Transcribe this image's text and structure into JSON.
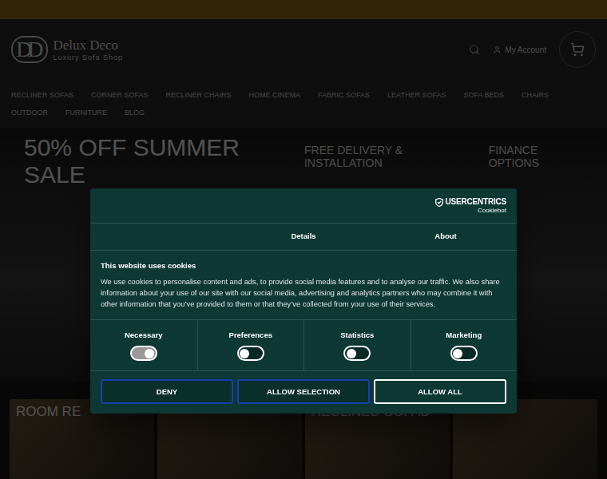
{
  "header": {
    "logo_mark": "DD",
    "logo_title": "Delux Deco",
    "logo_subtitle": "Luxury Sofa Shop",
    "account": "My Account"
  },
  "nav": [
    "RECLINER SOFAS",
    "CORNER SOFAS",
    "RECLINER CHAIRS",
    "HOME CINEMA",
    "FABRIC SOFAS",
    "LEATHER SOFAS",
    "SOFA BEDS",
    "CHAIRS",
    "OUTDOOR",
    "FURNITURE",
    "BLOG"
  ],
  "banner": {
    "headline": "50% OFF SUMMER SALE",
    "features": [
      "FREE DELIVERY & INSTALLATION",
      "FINANCE OPTIONS"
    ]
  },
  "tiles": [
    {
      "label": "ROOM RE"
    },
    {
      "label": ""
    },
    {
      "label": "RECLINED SOFAS"
    },
    {
      "label": ""
    }
  ],
  "cookie_dialog": {
    "brand": "USERCENTRICS",
    "brand_sub": "Cookiebot",
    "tabs": [
      {
        "label": "Details",
        "selected": false
      },
      {
        "label": "About",
        "selected": false
      }
    ],
    "title": "This website uses cookies",
    "body": "We use cookies to personalise content and ads, to provide social media features and to analyse our traffic. We also share information about your use of our site with our social media, advertising and analytics partners who may combine it with other information that you’ve provided to them or that they’ve collected from your use of their services.",
    "toggles": [
      {
        "label": "Necessary",
        "on": true,
        "disabled": true
      },
      {
        "label": "Preferences",
        "on": false,
        "disabled": false
      },
      {
        "label": "Statistics",
        "on": false,
        "disabled": false
      },
      {
        "label": "Marketing",
        "on": false,
        "disabled": false
      }
    ],
    "buttons": [
      {
        "label": "DENY",
        "kind": "outline"
      },
      {
        "label": "ALLOW SELECTION",
        "kind": "outline"
      },
      {
        "label": "ALLOW ALL",
        "kind": "primary"
      }
    ]
  }
}
